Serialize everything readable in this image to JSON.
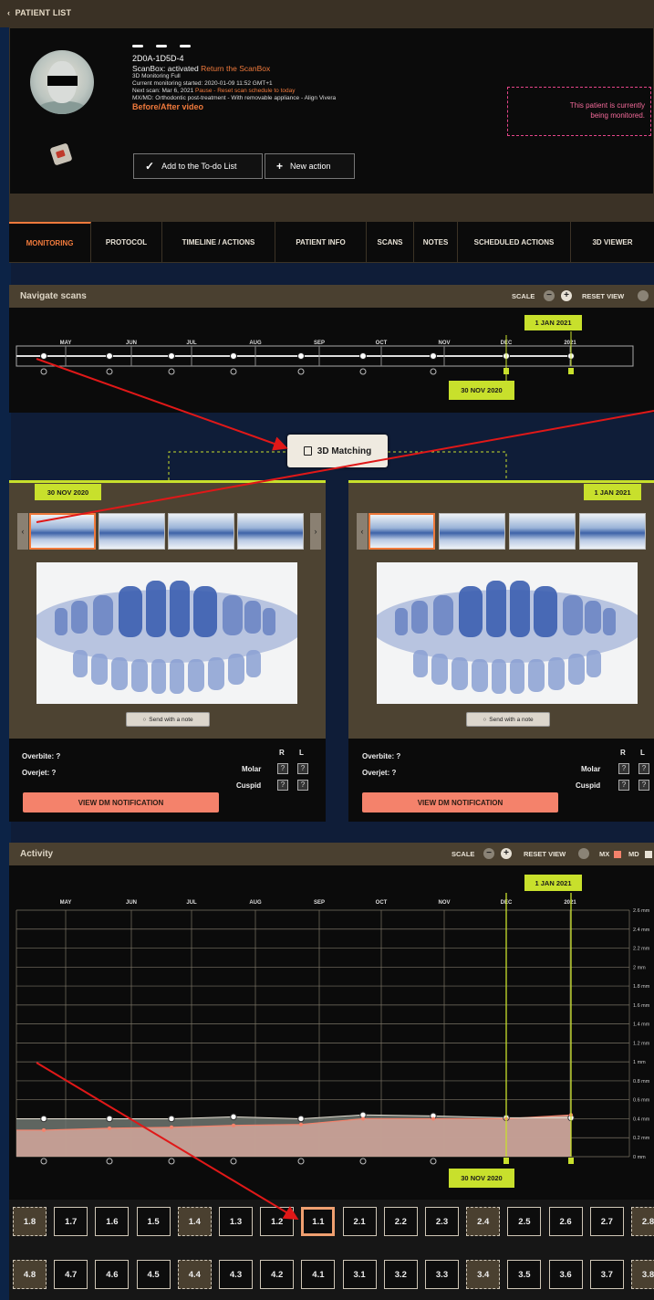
{
  "top": {
    "back_label": "PATIENT LIST"
  },
  "patient": {
    "id": "2D0A-1D5D-4",
    "scanbox_prefix": "ScanBox: activated ",
    "scanbox_link": "Return the ScanBox",
    "monitoring_type": "3D Monitoring Full",
    "monitoring_started": "Current monitoring started: 2020-01-09 11:52 GMT+1",
    "next_scan_prefix": "Next scan: Mar 6, 2021 ",
    "next_scan_actions": "Pause - Reset scan schedule to today",
    "treatment": "MX/MD: Orthodontic post-treatment - With removable appliance - Align Vivera",
    "video_link": "Before/After video",
    "todo_button": "Add to the To-do List",
    "new_action_button": "New action",
    "monitored_line1": "This patient is currently",
    "monitored_line2": "being monitored."
  },
  "tabs": [
    {
      "label": "MONITORING"
    },
    {
      "label": "PROTOCOL"
    },
    {
      "label": "TIMELINE / ACTIONS"
    },
    {
      "label": "PATIENT INFO"
    },
    {
      "label": "SCANS"
    },
    {
      "label": "NOTES"
    },
    {
      "label": "SCHEDULED ACTIONS"
    },
    {
      "label": "3D VIEWER"
    }
  ],
  "navigate": {
    "title": "Navigate scans",
    "scale_label": "SCALE",
    "reset_label": "RESET VIEW",
    "months": [
      "MAY",
      "JUN",
      "JUL",
      "AUG",
      "SEP",
      "OCT",
      "NOV",
      "DEC",
      "2021"
    ],
    "tag_top": "1 JAN 2021",
    "tag_bottom": "30 NOV 2020"
  },
  "matching": {
    "label": "3D Matching"
  },
  "cards": [
    {
      "date": "30 NOV 2020",
      "send_note": "Send with a note",
      "overbite": "Overbite: ?",
      "overjet": "Overjet: ?",
      "molar": "Molar",
      "cuspid": "Cuspid",
      "r": "R",
      "l": "L",
      "q": "?",
      "dm_button": "VIEW DM NOTIFICATION"
    },
    {
      "date": "1 JAN 2021",
      "send_note": "Send with a note",
      "overbite": "Overbite: ?",
      "overjet": "Overjet: ?",
      "molar": "Molar",
      "cuspid": "Cuspid",
      "r": "R",
      "l": "L",
      "q": "?",
      "dm_button": "VIEW DM NOTIFICATION"
    }
  ],
  "activity": {
    "title": "Activity",
    "scale_label": "SCALE",
    "reset_label": "RESET VIEW",
    "mx_label": "MX",
    "md_label": "MD",
    "tag_top": "1 JAN 2021",
    "tag_bottom": "30 NOV 2020",
    "colors": {
      "mx": "#f4826b",
      "md": "#e8e2d6",
      "accent": "#c8e02c",
      "orange": "#f07a3c"
    }
  },
  "chart_data": {
    "type": "area",
    "title": "Activity",
    "x": [
      "MAY",
      "JUN",
      "JUL",
      "AUG",
      "SEP",
      "OCT",
      "NOV",
      "DEC",
      "2021"
    ],
    "y_ticks": [
      "2.6 mm",
      "2.4 mm",
      "2.2 mm",
      "2 mm",
      "1.8 mm",
      "1.6 mm",
      "1.4 mm",
      "1.2 mm",
      "1 mm",
      "0.8 mm",
      "0.6 mm",
      "0.4 mm",
      "0.2 mm",
      "0 mm"
    ],
    "ylim": [
      0,
      2.6
    ],
    "series": [
      {
        "name": "MD",
        "values": [
          0.4,
          0.4,
          0.4,
          0.42,
          0.4,
          0.44,
          0.43,
          0.41,
          0.41
        ]
      },
      {
        "name": "MX",
        "values": [
          0.28,
          0.3,
          0.31,
          0.33,
          0.34,
          0.4,
          0.4,
          0.4,
          0.44
        ]
      }
    ],
    "legend": "top-right"
  },
  "teeth": {
    "upper": [
      "1.8",
      "1.7",
      "1.6",
      "1.5",
      "1.4",
      "1.3",
      "1.2",
      "1.1",
      "2.1",
      "2.2",
      "2.3",
      "2.4",
      "2.5",
      "2.6",
      "2.7",
      "2.8"
    ],
    "lower": [
      "4.8",
      "4.7",
      "4.6",
      "4.5",
      "4.4",
      "4.3",
      "4.2",
      "4.1",
      "3.1",
      "3.2",
      "3.3",
      "3.4",
      "3.5",
      "3.6",
      "3.7",
      "3.8"
    ],
    "selected": "1.1"
  }
}
